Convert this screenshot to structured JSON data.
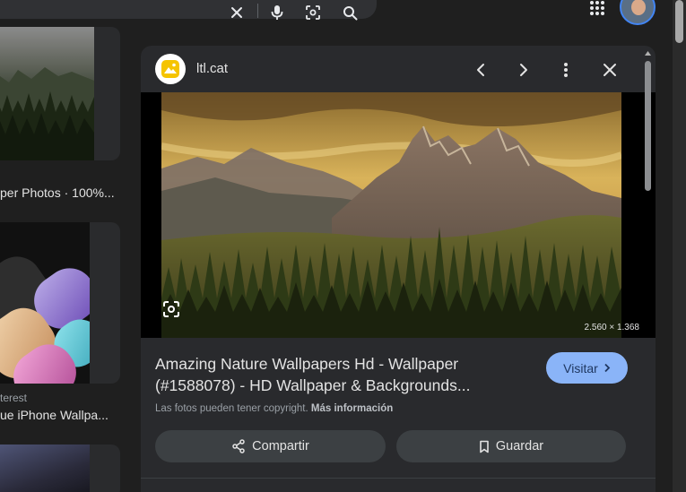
{
  "panel": {
    "site_name": "ltl.cat",
    "image_dimensions": "2.560 × 1.368",
    "title_line1": "Amazing Nature Wallpapers Hd - Wallpaper",
    "title_line2": "(#1588078) - HD Wallpaper & Backgrounds...",
    "visit_label": "Visitar",
    "copyright_text": "Las fotos pueden tener copyright.",
    "more_info_label": "Más información",
    "share_label": "Compartir",
    "save_label": "Guardar"
  },
  "left": {
    "result1_caption": "per Photos · 100%...",
    "result2_source": "terest",
    "result2_caption": "ue iPhone Wallpa..."
  },
  "colors": {
    "visit_button": "#8ab4f8",
    "panel_bg": "#292a2d",
    "page_bg": "#1f1f1f"
  },
  "icons": {
    "logo": "ltl-cat-logo-icon",
    "prev": "chevron-left-icon",
    "next": "chevron-right-icon",
    "more": "more-vert-icon",
    "close": "close-icon",
    "lens": "lens-icon",
    "share": "share-icon",
    "save": "bookmark-icon"
  }
}
